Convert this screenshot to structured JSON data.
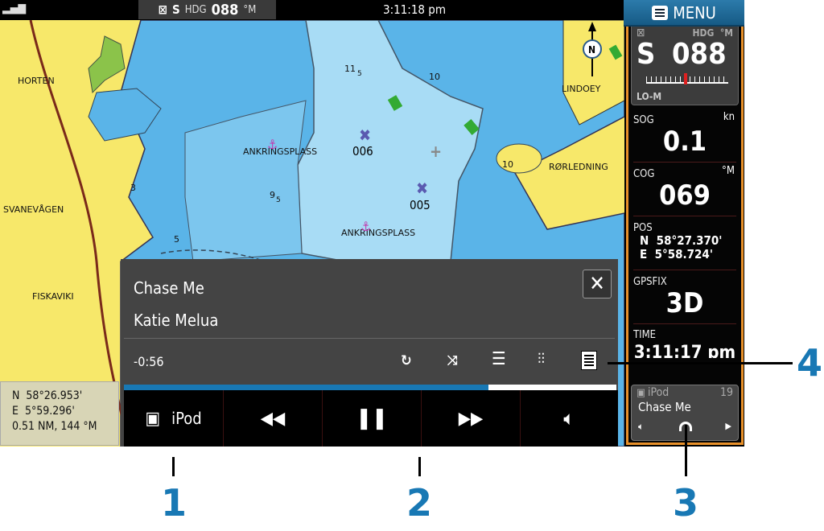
{
  "topbar": {
    "hdg_prefix": "S",
    "hdg_label": "HDG",
    "hdg_value": "088",
    "hdg_unit": "°M",
    "time": "3:11:18 pm"
  },
  "menu": {
    "label": "MENU"
  },
  "map": {
    "labels": {
      "horten": "HORTEN",
      "svanevagen": "SVANEVÅGEN",
      "fiskaviki": "FISKAVIKI",
      "lindoey": "LINDOEY",
      "rorledning": "RØRLEDNING",
      "anchor1": "ANKRINGSPLASS",
      "anchor2": "ANKRINGSPLASS"
    },
    "depths": {
      "d11": "11",
      "d11s": "5",
      "d10a": "10",
      "d10b": "10",
      "d9": "9",
      "d9s": "5",
      "d3": "3",
      "d5": "5"
    },
    "waypoints": [
      "006",
      "005"
    ],
    "north": "N"
  },
  "cursor_position": {
    "lat": "N  58°26.953'",
    "lon": "E  5°59.296'",
    "range": "0.51 NM, 144 °M"
  },
  "instruments": {
    "hdg": {
      "label": "HDG",
      "unit": "°M",
      "prefix": "S",
      "value": "088",
      "mode": "LO-M"
    },
    "sog": {
      "label": "SOG",
      "unit": "kn",
      "value": "0.1"
    },
    "cog": {
      "label": "COG",
      "unit": "°M",
      "value": "069"
    },
    "pos": {
      "label": "POS",
      "lat": "N  58°27.370'",
      "lon": "E  5°58.724'"
    },
    "gpsfix": {
      "label": "GPSFIX",
      "value": "3D"
    },
    "time": {
      "label": "TIME",
      "value": "3:11:17 pm"
    }
  },
  "mini_player": {
    "source": "iPod",
    "track_number": "19",
    "title": "Chase Me"
  },
  "media": {
    "title": "Chase Me",
    "artist": "Katie Melua",
    "remaining": "-0:56",
    "progress_pct": 74,
    "source_label": "iPod",
    "colors": {
      "progress": "#1878b4"
    }
  },
  "callouts": [
    "1",
    "2",
    "3",
    "4"
  ],
  "colors": {
    "land": "#f7e86a",
    "shallow": "#5ab4e8",
    "deep": "#a8dcf5",
    "panel_border": "#e8902a",
    "callout": "#1878b4"
  }
}
